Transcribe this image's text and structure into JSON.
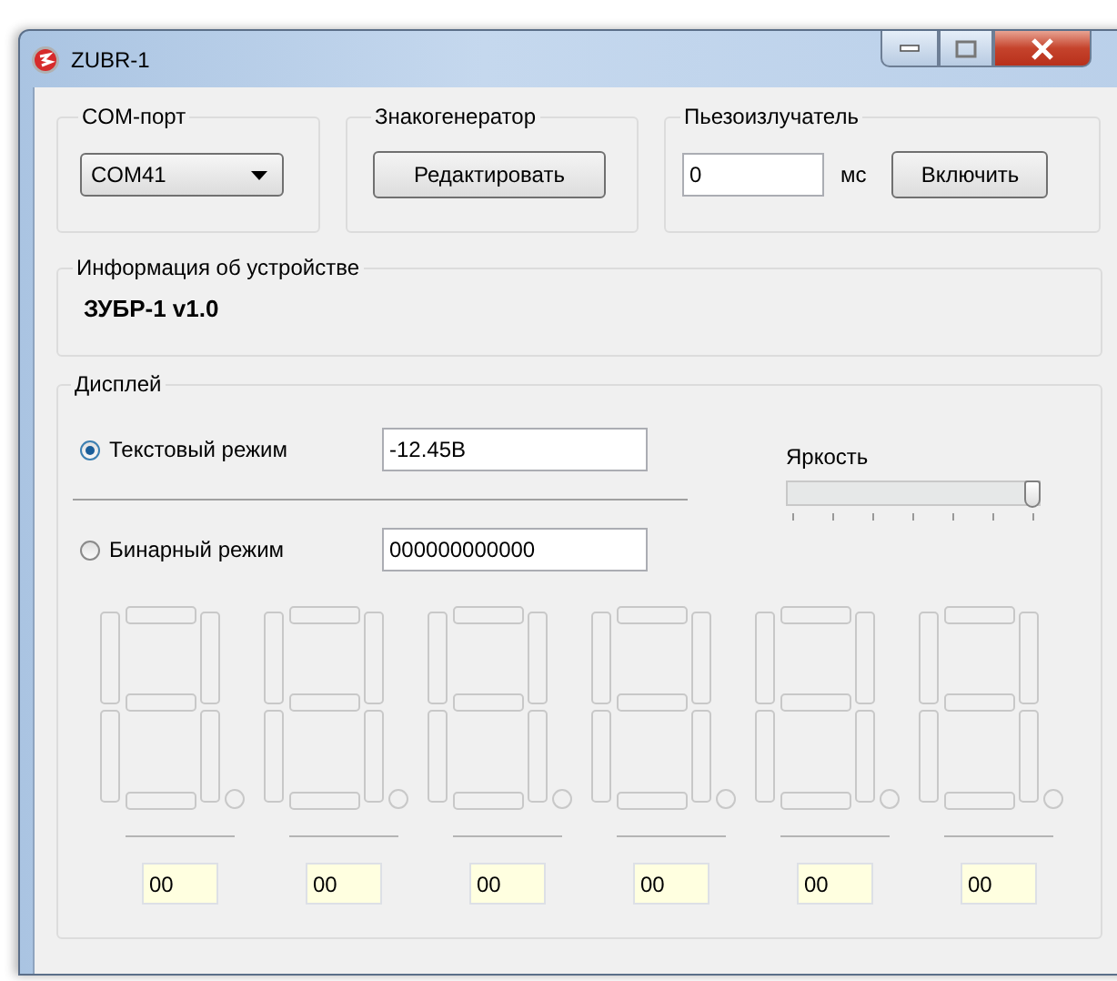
{
  "window": {
    "title": "ZUBR-1"
  },
  "com_port": {
    "label": "COM-порт",
    "value": "COM41"
  },
  "charset": {
    "label": "Знакогенератор",
    "button": "Редактировать"
  },
  "buzzer": {
    "label": "Пьезоизлучатель",
    "duration": "0",
    "unit": "мс",
    "button": "Включить"
  },
  "device_info": {
    "label": "Информация об устройстве",
    "value": "ЗУБР-1 v1.0"
  },
  "display": {
    "label": "Дисплей",
    "modes": [
      {
        "label": "Текстовый режим",
        "selected": true,
        "value": "-12.45В"
      },
      {
        "label": "Бинарный режим",
        "selected": false,
        "value": "000000000000"
      }
    ],
    "brightness": {
      "label": "Яркость",
      "level": 1
    },
    "digits": [
      {
        "code": "00"
      },
      {
        "code": "00"
      },
      {
        "code": "00"
      },
      {
        "code": "00"
      },
      {
        "code": "00"
      },
      {
        "code": "00"
      }
    ]
  }
}
